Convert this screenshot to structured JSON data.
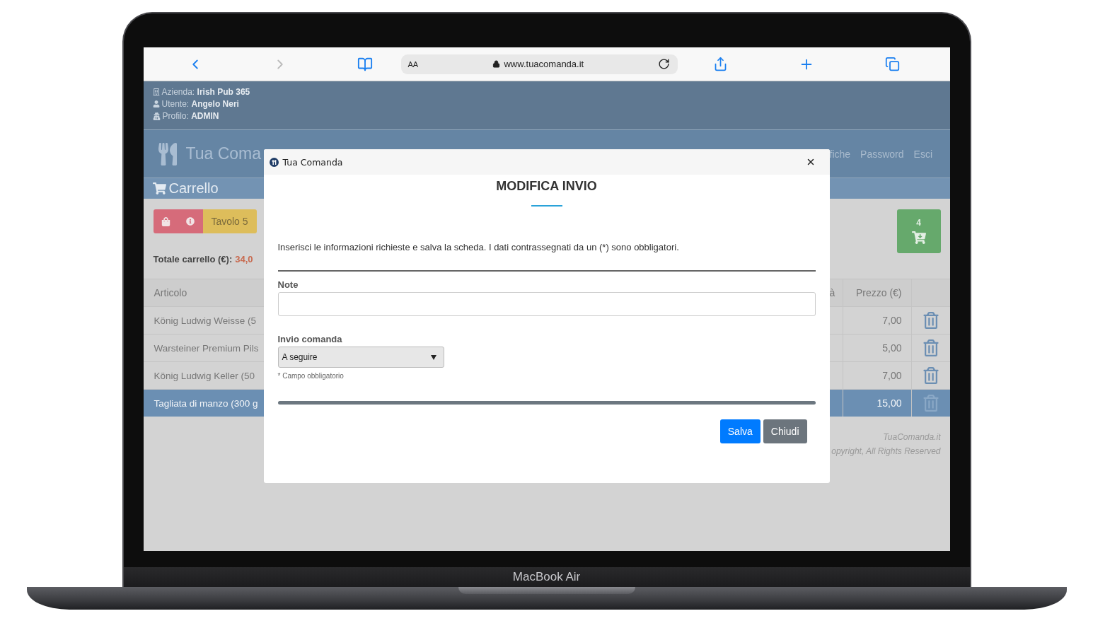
{
  "device": {
    "label": "MacBook Air"
  },
  "browser": {
    "text_size_button": "AA",
    "url": "www.tuacomanda.it"
  },
  "info_bar": [
    {
      "kind": "company",
      "label": "Azienda:",
      "value": "Irish Pub 365"
    },
    {
      "kind": "user",
      "label": "Utente:",
      "value": "Angelo Neri"
    },
    {
      "kind": "profile",
      "label": "Profilo:",
      "value": "ADMIN"
    }
  ],
  "nav": {
    "brand": "Tua Coma",
    "links": [
      "fiche",
      "Password",
      "Esci"
    ]
  },
  "cart": {
    "title": "Carrello",
    "table_button": "Tavolo 5",
    "total_label": "Totale carrello (€):",
    "total_value": "34,0",
    "badge_count": "4"
  },
  "table": {
    "columns": [
      "Articolo",
      "à",
      "Prezzo (€)"
    ],
    "rows": [
      {
        "item": "König Ludwig Weisse (5",
        "price": "7,00",
        "selected": false
      },
      {
        "item": "Warsteiner Premium Pils",
        "price": "5,00",
        "selected": false
      },
      {
        "item": "König Ludwig Keller (50",
        "price": "7,00",
        "selected": false
      },
      {
        "item": "Tagliata di manzo (300 g",
        "price": "15,00",
        "selected": true
      }
    ]
  },
  "footer": [
    "TuaComanda.it",
    "opyright, All Rights Reserved"
  ],
  "modal": {
    "title": "Tua Comanda",
    "heading": "MODIFICA INVIO",
    "description": "Inserisci le informazioni richieste e salva la scheda. I dati contrassegnati da un (*) sono obbligatori.",
    "fields": [
      {
        "kind": "text",
        "label": "Note"
      },
      {
        "kind": "select",
        "label": "Invio comanda",
        "value": "A seguire"
      }
    ],
    "required_note": "* Campo obbligatorio",
    "buttons": [
      {
        "kind": "primary",
        "label": "Salva"
      },
      {
        "kind": "secondary",
        "label": "Chiudi"
      }
    ]
  }
}
